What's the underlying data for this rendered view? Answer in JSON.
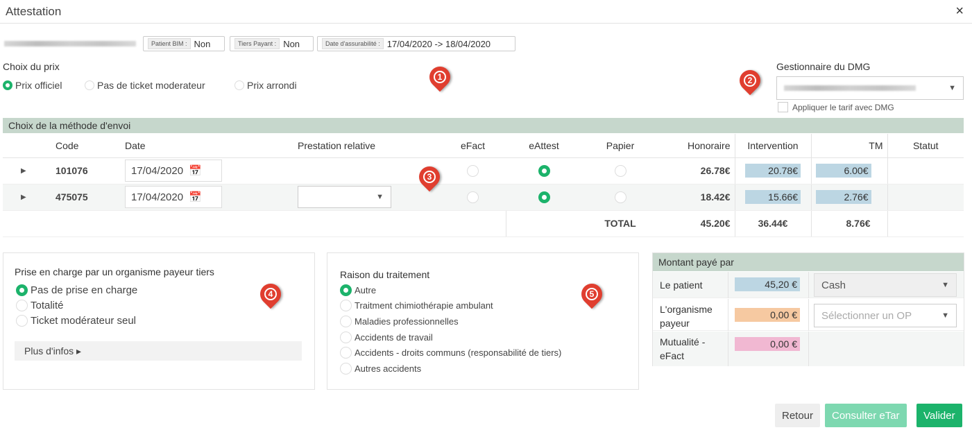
{
  "modal": {
    "title": "Attestation",
    "close": "×"
  },
  "info_tags": [
    {
      "key": "Patient BIM :",
      "value": "Non"
    },
    {
      "key": "Tiers Payant :",
      "value": "Non"
    },
    {
      "key": "Date d'assurabilité :",
      "value": "17/04/2020 -> 18/04/2020"
    }
  ],
  "prix": {
    "title": "Choix du prix",
    "options": [
      {
        "label": "Prix officiel",
        "selected": true
      },
      {
        "label": "Pas de ticket moderateur",
        "selected": false
      },
      {
        "label": "Prix arrondi",
        "selected": false
      }
    ]
  },
  "dmg": {
    "title": "Gestionnaire du DMG",
    "checkbox_label": "Appliquer le tarif avec DMG"
  },
  "envoi": {
    "title": "Choix de la méthode d'envoi",
    "columns": [
      "Code",
      "Date",
      "Prestation relative",
      "eFact",
      "eAttest",
      "Papier",
      "Honoraire",
      "Intervention",
      "TM",
      "Statut"
    ],
    "rows": [
      {
        "code": "101076",
        "date": "17/04/2020",
        "prestation": "",
        "honoraire": "26.78€",
        "intervention": "20.78€",
        "tm": "6.00€"
      },
      {
        "code": "475075",
        "date": "17/04/2020",
        "prestation": "",
        "honoraire": "18.42€",
        "intervention": "15.66€",
        "tm": "2.76€"
      }
    ],
    "total": {
      "label": "TOTAL",
      "honoraire": "45.20€",
      "intervention": "36.44€",
      "tm": "8.76€"
    }
  },
  "tiers": {
    "title": "Prise en charge par un organisme payeur tiers",
    "options": [
      {
        "label": "Pas de prise en charge",
        "selected": true
      },
      {
        "label": "Totalité",
        "selected": false
      },
      {
        "label": "Ticket modérateur seul",
        "selected": false
      }
    ],
    "more": "Plus d'infos ▸"
  },
  "raison": {
    "title": "Raison du traitement",
    "options": [
      {
        "label": "Autre",
        "selected": true
      },
      {
        "label": "Traitment chimiothérapie ambulant",
        "selected": false
      },
      {
        "label": "Maladies professionnelles",
        "selected": false
      },
      {
        "label": "Accidents de travail",
        "selected": false
      },
      {
        "label": "Accidents - droits communs (responsabilité de tiers)",
        "selected": false
      },
      {
        "label": "Autres accidents",
        "selected": false
      }
    ]
  },
  "montant": {
    "title": "Montant payé par",
    "rows": [
      {
        "label": "Le patient",
        "amount": "45,20 €",
        "select": "Cash",
        "color": "#bcd6e3"
      },
      {
        "label": "L'organisme payeur",
        "amount": "0,00 €",
        "select": "Sélectionner un OP",
        "color": "#f6c9a1"
      },
      {
        "label": "Mutualité - eFact",
        "amount": "0,00 €",
        "select": "",
        "color": "#f1b8d2"
      }
    ]
  },
  "markers": [
    "1",
    "2",
    "3",
    "4",
    "5"
  ],
  "buttons": {
    "retour": "Retour",
    "etar": "Consulter eTar",
    "valider": "Valider"
  },
  "colors": {
    "accent": "#1cb36b",
    "section": "#c6d7cc",
    "highlight_blue": "#bcd6e3",
    "marker": "#e03e2f"
  }
}
